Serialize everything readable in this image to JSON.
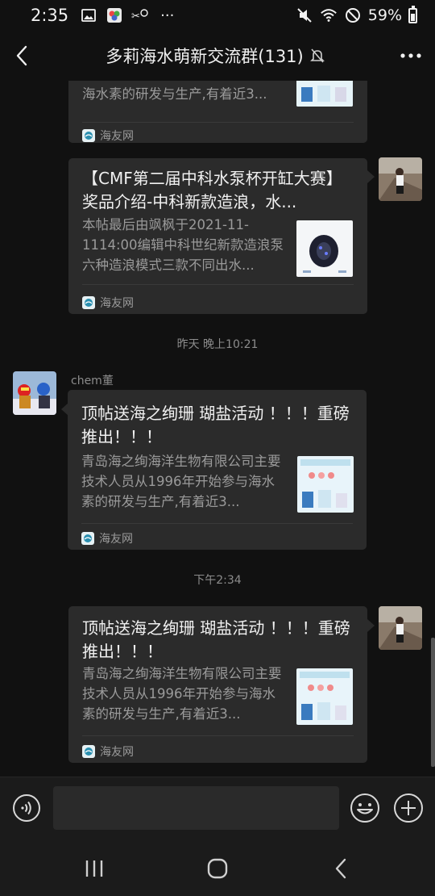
{
  "status_bar": {
    "time": "2:35",
    "more": "···",
    "battery": "59%",
    "battery_level": 0.59
  },
  "header": {
    "title": "多莉海水萌新交流群(131)",
    "back_icon": "chevron-left-icon",
    "mute_icon": "bell-off-icon",
    "more_icon": "more-dots-icon"
  },
  "messages": [
    {
      "title": "",
      "desc": "海水素的研发与生产,有着近3...",
      "source": "海友网"
    },
    {
      "title": "【CMF第二届中科水泵杯开缸大赛】奖品介绍-中科新款造浪，水...",
      "desc": "本帖最后由飒枫于2021-11-1114:00编辑中科世纪新款造浪泵六种造浪模式三款不同出水...",
      "source": "海友网"
    },
    {
      "timestamp": "昨天 晚上10:21"
    },
    {
      "sender": "chem董",
      "title": "顶帖送海之绚珊 瑚盐活动 ！！！重磅推出！！！",
      "desc": "青岛海之绚海洋生物有限公司主要技术人员从1996年开始参与海水素的研发与生产,有着近3...",
      "source": "海友网"
    },
    {
      "timestamp": "下午2:34"
    },
    {
      "title": "顶帖送海之绚珊 瑚盐活动 ！！！重磅推出！！！",
      "desc": "青岛海之绚海洋生物有限公司主要技术人员从1996年开始参与海水素的研发与生产,有着近3...",
      "source": "海友网"
    }
  ],
  "input": {
    "value": "",
    "voice_icon": "voice-icon",
    "emoji_icon": "emoji-icon",
    "plus_icon": "plus-circle-icon"
  },
  "colors": {
    "background": "#111111",
    "bubble": "#2b2b2b",
    "muted_text": "#9a9a9a"
  }
}
